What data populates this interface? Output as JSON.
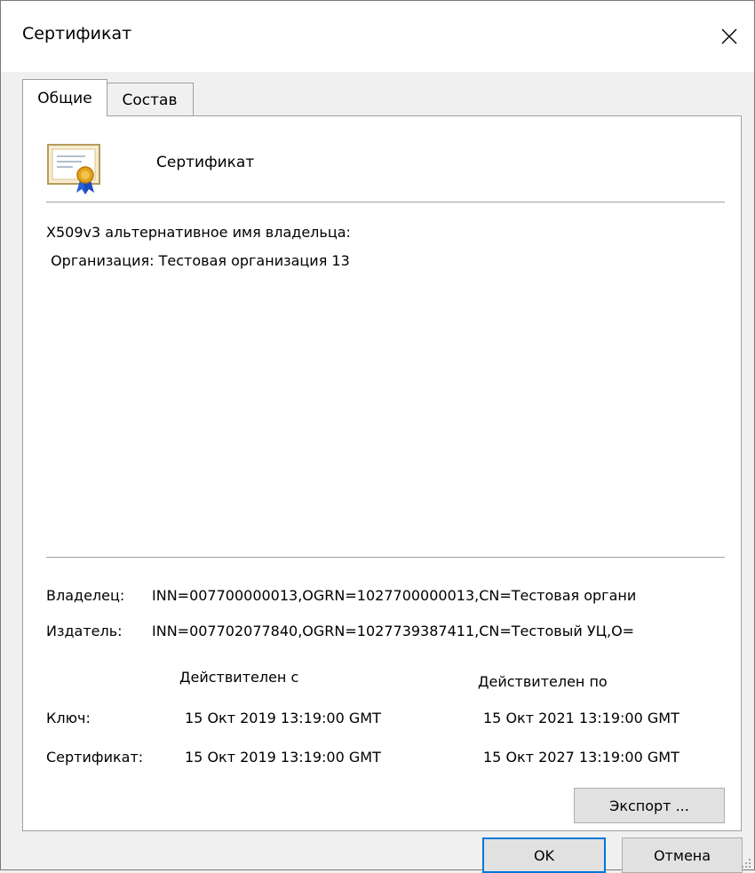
{
  "window": {
    "title": "Сертификат"
  },
  "tabs": [
    {
      "label": "Общие"
    },
    {
      "label": "Состав"
    }
  ],
  "certificate": {
    "name": "Сертификат",
    "details_line1": "X509v3 альтернативное имя владельца:",
    "details_line2": " Организация: Тестовая организация 13"
  },
  "owner": {
    "label": "Владелец:",
    "value": "INN=007700000013,OGRN=1027700000013,CN=Тестовая органи"
  },
  "issuer": {
    "label": "Издатель:",
    "value": "INN=007702077840,OGRN=1027739387411,CN=Тестовый УЦ,O="
  },
  "validity": {
    "from_header": "Действителен с",
    "to_header": "Действителен по",
    "rows": [
      {
        "label": "Ключ:",
        "from": "15 Окт 2019 13:19:00 GMT",
        "to": "15 Окт 2021 13:19:00 GMT"
      },
      {
        "label": "Сертификат:",
        "from": "15 Окт 2019 13:19:00 GMT",
        "to": "15 Окт 2027 13:19:00 GMT"
      }
    ]
  },
  "buttons": {
    "export_label": "Экспорт ...",
    "ok_label": "OK",
    "cancel_label": "Отмена"
  },
  "icons": {
    "close": "close-icon",
    "certificate": "certificate-icon"
  }
}
